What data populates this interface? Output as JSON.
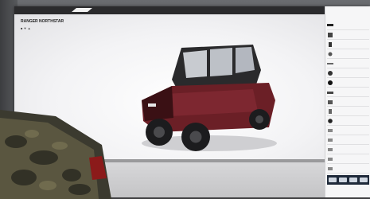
{
  "viewport": {
    "model_title": "RANGER NORTHSTAR",
    "model_sub": "■ ▼ ▲"
  },
  "panel": {
    "title": "",
    "subtitle": "",
    "options": [
      {
        "icon": "roof-icon",
        "label": ""
      },
      {
        "icon": "cab-icon",
        "label": ""
      },
      {
        "icon": "door-icon",
        "label": ""
      },
      {
        "icon": "mirror-icon",
        "label": ""
      },
      {
        "icon": "light-icon",
        "label": ""
      },
      {
        "icon": "winch-icon",
        "label": ""
      },
      {
        "icon": "wheel-icon",
        "label": ""
      },
      {
        "icon": "bumper-icon",
        "label": ""
      },
      {
        "icon": "storage-icon",
        "label": ""
      },
      {
        "icon": "seat-icon",
        "label": ""
      },
      {
        "icon": "tire-icon",
        "label": ""
      },
      {
        "icon": "accessory-icon",
        "label": ""
      },
      {
        "icon": "accessory-icon",
        "label": ""
      },
      {
        "icon": "accessory-icon",
        "label": ""
      },
      {
        "icon": "accessory-icon",
        "label": ""
      },
      {
        "icon": "accessory-icon",
        "label": ""
      }
    ],
    "total_label": ""
  },
  "colors": {
    "vehicle_body": "#6b1f26",
    "panel_button_bar": "#1f2a3a"
  }
}
